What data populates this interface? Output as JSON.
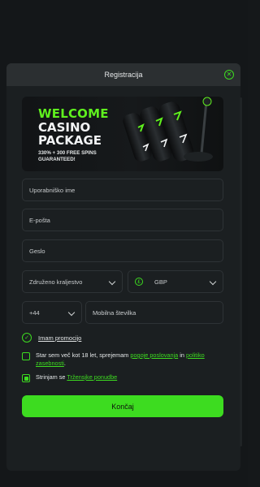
{
  "modal": {
    "title": "Registracija"
  },
  "banner": {
    "line1": "WELCOME",
    "line2": "CASINO",
    "line3": "PACKAGE",
    "sub1": "330% + 300 FREE SPINS",
    "sub2": "GUARANTEED!"
  },
  "form": {
    "username_placeholder": "Uporabniško ime",
    "email_placeholder": "E-pošta",
    "password_placeholder": "Geslo",
    "country_value": "Združeno kraljestvo",
    "currency_value": "GBP",
    "currency_icon": "£",
    "phone_code_value": "+44",
    "mobile_placeholder": "Mobilna številka"
  },
  "promo": {
    "label": "Imam promocijo"
  },
  "terms": {
    "text_before": "Star sem več kot 18 let, sprejemam ",
    "link1": "pogoje poslovanja",
    "mid": " in ",
    "link2": "politiko zasebnosti",
    "after": ".",
    "checked": false
  },
  "marketing": {
    "text_before": "Strinjam se ",
    "link": "Tržensjke ponudbe",
    "checked": true
  },
  "submit": {
    "label": "Končaj"
  },
  "colors": {
    "accent": "#3ddc20",
    "background": "#15181a",
    "modal": "#1b1f21",
    "header": "#2b2f31"
  }
}
